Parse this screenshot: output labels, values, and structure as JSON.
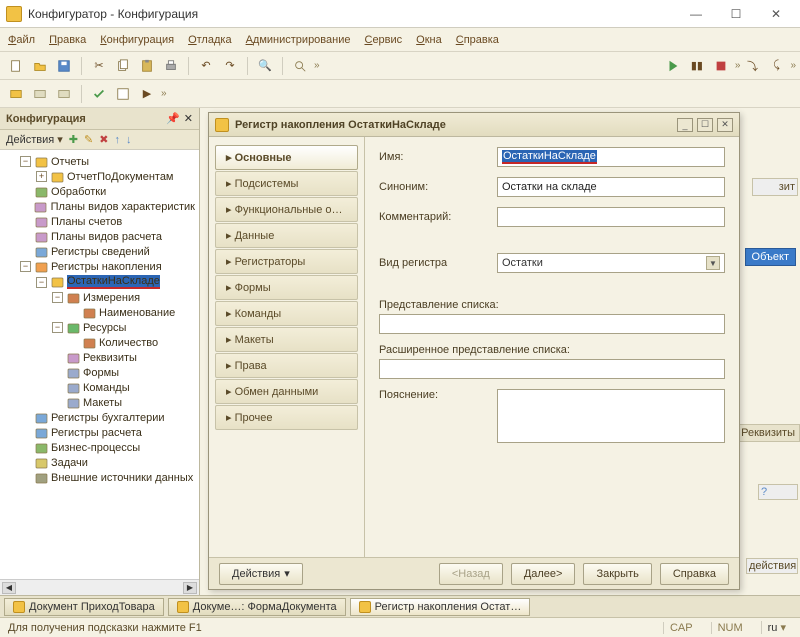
{
  "window": {
    "title": "Конфигуратор - Конфигурация"
  },
  "menu": [
    "Файл",
    "Правка",
    "Конфигурация",
    "Отладка",
    "Администрирование",
    "Сервис",
    "Окна",
    "Справка"
  ],
  "leftPanel": {
    "title": "Конфигурация",
    "actionsLabel": "Действия"
  },
  "tree": [
    {
      "lvl": 1,
      "tw": "−",
      "icon": "report",
      "label": "Отчеты"
    },
    {
      "lvl": 2,
      "tw": "+",
      "icon": "report-item",
      "label": "ОтчетПоДокументам"
    },
    {
      "lvl": 1,
      "tw": "",
      "icon": "proc",
      "label": "Обработки"
    },
    {
      "lvl": 1,
      "tw": "",
      "icon": "plan",
      "label": "Планы видов характеристик"
    },
    {
      "lvl": 1,
      "tw": "",
      "icon": "plan",
      "label": "Планы счетов"
    },
    {
      "lvl": 1,
      "tw": "",
      "icon": "plan",
      "label": "Планы видов расчета"
    },
    {
      "lvl": 1,
      "tw": "",
      "icon": "reg",
      "label": "Регистры сведений"
    },
    {
      "lvl": 1,
      "tw": "−",
      "icon": "reg-acc",
      "label": "Регистры накопления"
    },
    {
      "lvl": 2,
      "tw": "−",
      "icon": "reg-item",
      "label": "ОстаткиНаСкладе",
      "selected": true
    },
    {
      "lvl": 3,
      "tw": "−",
      "icon": "dim",
      "label": "Измерения"
    },
    {
      "lvl": 4,
      "tw": "",
      "icon": "field",
      "label": "Наименование"
    },
    {
      "lvl": 3,
      "tw": "−",
      "icon": "res",
      "label": "Ресурсы"
    },
    {
      "lvl": 4,
      "tw": "",
      "icon": "field",
      "label": "Количество"
    },
    {
      "lvl": 3,
      "tw": "",
      "icon": "attr",
      "label": "Реквизиты"
    },
    {
      "lvl": 3,
      "tw": "",
      "icon": "forms",
      "label": "Формы"
    },
    {
      "lvl": 3,
      "tw": "",
      "icon": "cmds",
      "label": "Команды"
    },
    {
      "lvl": 3,
      "tw": "",
      "icon": "tmpl",
      "label": "Макеты"
    },
    {
      "lvl": 1,
      "tw": "",
      "icon": "reg",
      "label": "Регистры бухгалтерии"
    },
    {
      "lvl": 1,
      "tw": "",
      "icon": "reg",
      "label": "Регистры расчета"
    },
    {
      "lvl": 1,
      "tw": "",
      "icon": "bp",
      "label": "Бизнес-процессы"
    },
    {
      "lvl": 1,
      "tw": "",
      "icon": "task",
      "label": "Задачи"
    },
    {
      "lvl": 1,
      "tw": "",
      "icon": "ext",
      "label": "Внешние источники данных"
    }
  ],
  "dialog": {
    "title": "Регистр накопления ОстаткиНаСкладе",
    "tabs": [
      "Основные",
      "Подсистемы",
      "Функциональные опции",
      "Данные",
      "Регистраторы",
      "Формы",
      "Команды",
      "Макеты",
      "Права",
      "Обмен данными",
      "Прочее"
    ],
    "activeTab": 0,
    "fields": {
      "name_label": "Имя:",
      "name_value": "ОстаткиНаСкладе",
      "synonym_label": "Синоним:",
      "synonym_value": "Остатки на складе",
      "comment_label": "Комментарий:",
      "comment_value": "",
      "regtype_label": "Вид регистра",
      "regtype_value": "Остатки",
      "listrep_label": "Представление списка:",
      "extlistrep_label": "Расширенное представление списка:",
      "explain_label": "Пояснение:"
    },
    "footer": {
      "actions": "Действия",
      "back": "<Назад",
      "next": "Далее>",
      "close": "Закрыть",
      "help": "Справка"
    }
  },
  "bg": {
    "object": "Объект",
    "rekv": "Реквизиты",
    "zit": "зит",
    "deist": "действия"
  },
  "docTabs": [
    {
      "label": "Документ ПриходТовара"
    },
    {
      "label": "Докуме…: ФормаДокумента"
    },
    {
      "label": "Регистр накопления Остат…",
      "active": true
    }
  ],
  "status": {
    "hint": "Для получения подсказки нажмите F1",
    "cap": "CAP",
    "num": "NUM",
    "lang": "ru"
  }
}
